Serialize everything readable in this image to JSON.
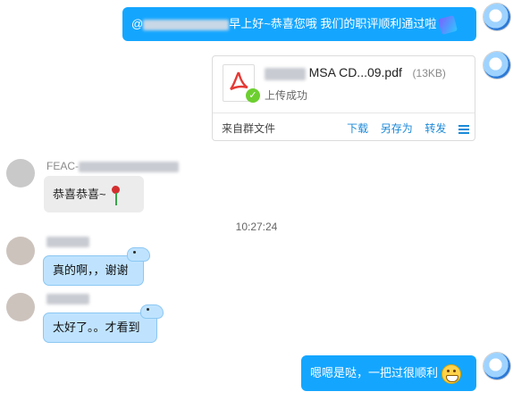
{
  "messages": [
    {
      "id": "m1",
      "text_suffix": "早上好~恭喜您哦 我们的职评顺利通过啦",
      "prefix": "@"
    },
    {
      "id": "m2",
      "file_name": "MSA CD...09.pdf",
      "file_size": "(13KB)",
      "status": "上传成功",
      "source": "来自群文件",
      "actions": [
        "下载",
        "另存为",
        "转发"
      ]
    },
    {
      "id": "m3",
      "sender_prefix": "FEAC-",
      "text": "恭喜恭喜~"
    },
    {
      "id": "m4",
      "text": "真的啊，，谢谢"
    },
    {
      "id": "m5",
      "text": "太好了。。才看到"
    },
    {
      "id": "m6",
      "text": "嗯嗯是哒，一把过很顺利"
    }
  ],
  "timestamp": "10:27:24",
  "colors": {
    "self_bubble": "#14a6ff",
    "other_bubble": "#ececec",
    "pale_bubble": "#bfe3ff",
    "link": "#1c8ad8"
  }
}
